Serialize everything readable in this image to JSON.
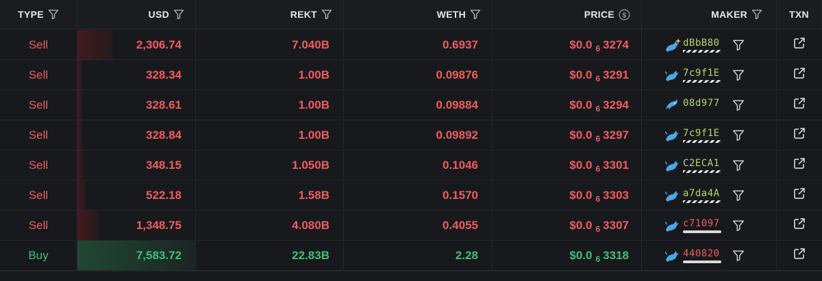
{
  "headers": {
    "type": "TYPE",
    "usd": "USD",
    "rekt": "REKT",
    "weth": "WETH",
    "price": "PRICE",
    "maker": "MAKER",
    "txn": "TXN"
  },
  "rows": [
    {
      "type": "Sell",
      "usd": "2,306.74",
      "rekt": "7.040B",
      "weth": "0.6937",
      "price_prefix": "$0.0",
      "price_sub": "6",
      "price_tail": "3274",
      "maker": "dBbB80",
      "maker_icon": "whale-sparkle",
      "maker_badge": "striped",
      "usd_bar": 0.3
    },
    {
      "type": "Sell",
      "usd": "328.34",
      "rekt": "1.00B",
      "weth": "0.09876",
      "price_prefix": "$0.0",
      "price_sub": "6",
      "price_tail": "3291",
      "maker": "7c9f1E",
      "maker_icon": "whale",
      "maker_badge": "striped",
      "usd_bar": 0.04
    },
    {
      "type": "Sell",
      "usd": "328.61",
      "rekt": "1.00B",
      "weth": "0.09884",
      "price_prefix": "$0.0",
      "price_sub": "6",
      "price_tail": "3294",
      "maker": "08d977",
      "maker_icon": "dolphin",
      "maker_badge": "none",
      "usd_bar": 0.04
    },
    {
      "type": "Sell",
      "usd": "328.84",
      "rekt": "1.00B",
      "weth": "0.09892",
      "price_prefix": "$0.0",
      "price_sub": "6",
      "price_tail": "3297",
      "maker": "7c9f1E",
      "maker_icon": "whale",
      "maker_badge": "striped",
      "usd_bar": 0.04
    },
    {
      "type": "Sell",
      "usd": "348.15",
      "rekt": "1.050B",
      "weth": "0.1046",
      "price_prefix": "$0.0",
      "price_sub": "6",
      "price_tail": "3301",
      "maker": "C2ECA1",
      "maker_icon": "whale",
      "maker_badge": "striped",
      "usd_bar": 0.05
    },
    {
      "type": "Sell",
      "usd": "522.18",
      "rekt": "1.58B",
      "weth": "0.1570",
      "price_prefix": "$0.0",
      "price_sub": "6",
      "price_tail": "3303",
      "maker": "a7da4A",
      "maker_icon": "whale",
      "maker_badge": "striped",
      "usd_bar": 0.07
    },
    {
      "type": "Sell",
      "usd": "1,348.75",
      "rekt": "4.080B",
      "weth": "0.4055",
      "price_prefix": "$0.0",
      "price_sub": "6",
      "price_tail": "3307",
      "maker": "c71097",
      "maker_icon": "whale",
      "maker_badge": "solid",
      "usd_bar": 0.18
    },
    {
      "type": "Buy",
      "usd": "7,583.72",
      "rekt": "22.83B",
      "weth": "2.28",
      "price_prefix": "$0.0",
      "price_sub": "6",
      "price_tail": "3318",
      "maker": "440820",
      "maker_icon": "whale",
      "maker_badge": "solid",
      "usd_bar": 1.0
    }
  ],
  "colors": {
    "sell": "#f05d5d",
    "buy": "#3fc07a",
    "address": "#b6d86a"
  }
}
